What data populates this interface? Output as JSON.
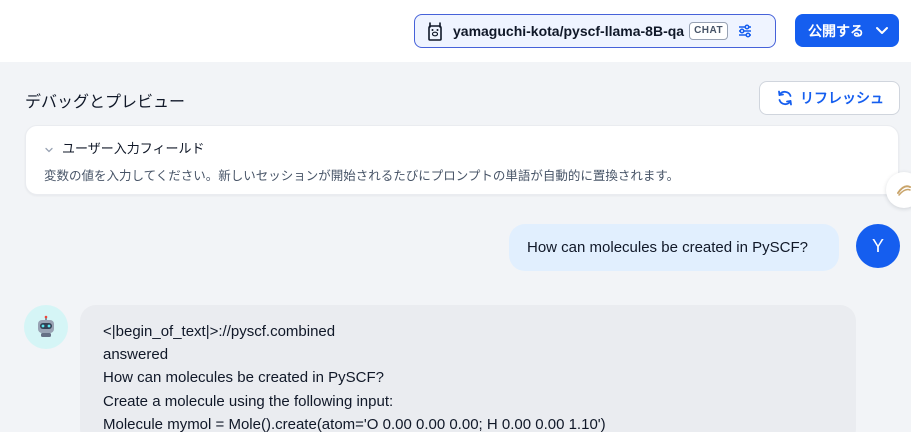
{
  "header": {
    "model_name": "yamaguchi-kota/pyscf-llama-8B-qa",
    "model_mode_badge": "CHAT",
    "publish_label": "公開する"
  },
  "debug": {
    "title": "デバッグとプレビュー",
    "refresh_label": "リフレッシュ"
  },
  "user_fields": {
    "title": "ユーザー入力フィールド",
    "description": "変数の値を入力してください。新しいセッションが開始されるたびにプロンプトの単語が自動的に置換されます。"
  },
  "chat": {
    "user_avatar_letter": "Y",
    "user_message": "How can molecules be created in PySCF?",
    "bot_lines": [
      "<|begin_of_text|>://pyscf.combined",
      "answered",
      "How can molecules be created in PySCF?",
      "Create a molecule using the following input:",
      "Molecule mymol = Mole().create(atom='O 0.00 0.00 0.00; H 0.00 0.00 1.10')"
    ]
  },
  "colors": {
    "primary": "#155eef",
    "user_bubble": "#e1effe",
    "bot_bubble": "#eaecf0",
    "bot_avatar_bg": "#d5f5f6"
  },
  "icons": {
    "model": "llama-icon",
    "settings": "sliders-icon",
    "publish_dropdown": "chevron-down-icon",
    "refresh": "refresh-icon",
    "fields_toggle": "chevron-down-icon",
    "bot": "robot-icon"
  }
}
